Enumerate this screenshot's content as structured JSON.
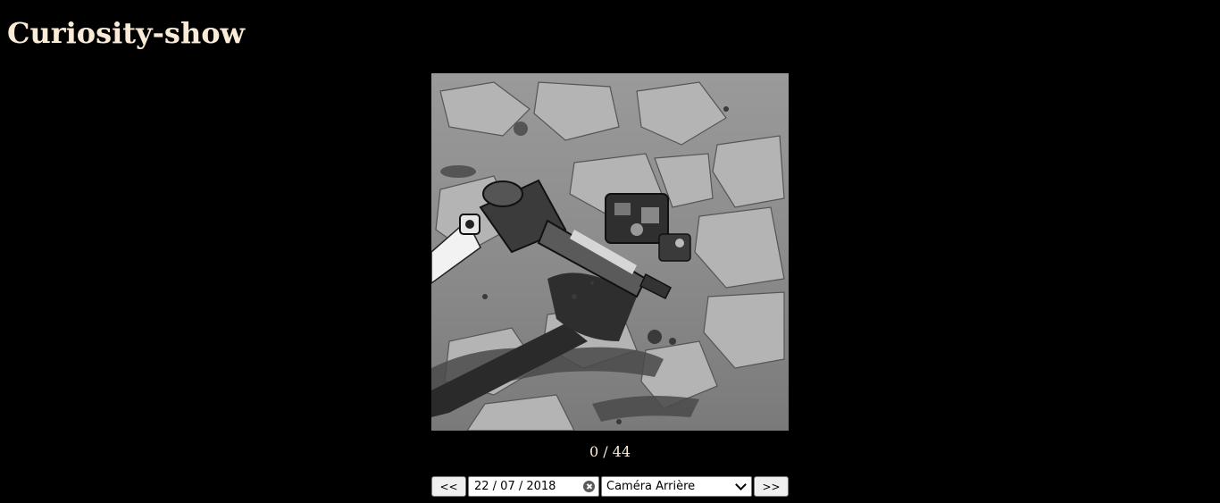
{
  "app": {
    "title": "Curiosity-show"
  },
  "viewer": {
    "counter": "0 / 44"
  },
  "controls": {
    "prev_label": "<<",
    "next_label": ">>",
    "date_value": "22 / 07 / 2018",
    "camera_selected": "Caméra Arrière"
  },
  "colors": {
    "background": "#000000",
    "text": "#faebd7"
  },
  "icons": {
    "date_clear": "clear-icon",
    "select_toggle": "chevron-down-icon"
  }
}
